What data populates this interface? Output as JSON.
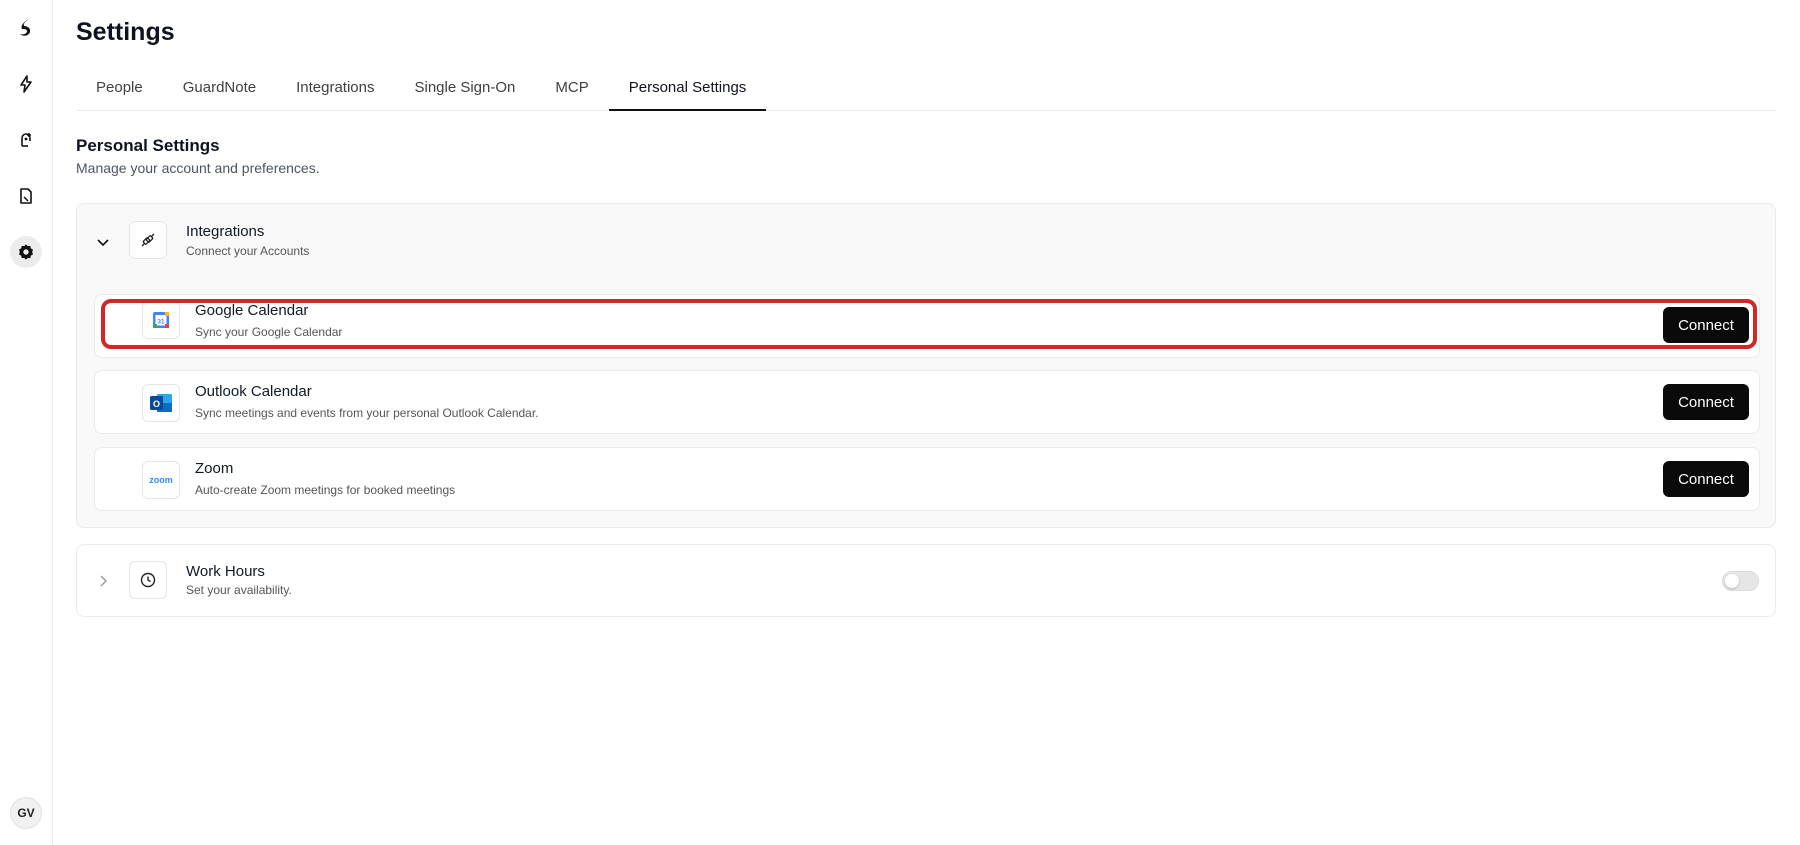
{
  "page": {
    "title": "Settings"
  },
  "rail": {
    "icons": [
      "app-logo-icon",
      "lightning-bolt-icon",
      "agent-icon",
      "document-icon",
      "gear-icon"
    ],
    "avatar_initials": "GV"
  },
  "tabs": [
    {
      "label": "People"
    },
    {
      "label": "GuardNote"
    },
    {
      "label": "Integrations"
    },
    {
      "label": "Single Sign-On"
    },
    {
      "label": "MCP"
    },
    {
      "label": "Personal Settings",
      "active": true
    }
  ],
  "section": {
    "title": "Personal Settings",
    "subtitle": "Manage your account and preferences."
  },
  "integrations_panel": {
    "title": "Integrations",
    "subtitle": "Connect your Accounts",
    "expanded": true,
    "items": [
      {
        "name": "Google Calendar",
        "description": "Sync your Google Calendar",
        "button": "Connect",
        "icon": "google-calendar-icon",
        "calendar_day": "31"
      },
      {
        "name": "Outlook Calendar",
        "description": "Sync meetings and events from your personal Outlook Calendar.",
        "button": "Connect",
        "icon": "outlook-icon",
        "logo_letter": "O"
      },
      {
        "name": "Zoom",
        "description": "Auto-create Zoom meetings for booked meetings",
        "button": "Connect",
        "icon": "zoom-icon",
        "logo_text": "zoom"
      }
    ]
  },
  "work_hours_panel": {
    "title": "Work Hours",
    "subtitle": "Set your availability.",
    "expanded": false,
    "toggle_on": false
  },
  "colors": {
    "highlight": "#d32626",
    "button_bg": "#0a0a0a",
    "zoom_blue": "#2d8cff",
    "outlook_blue": "#0f6cbd"
  }
}
